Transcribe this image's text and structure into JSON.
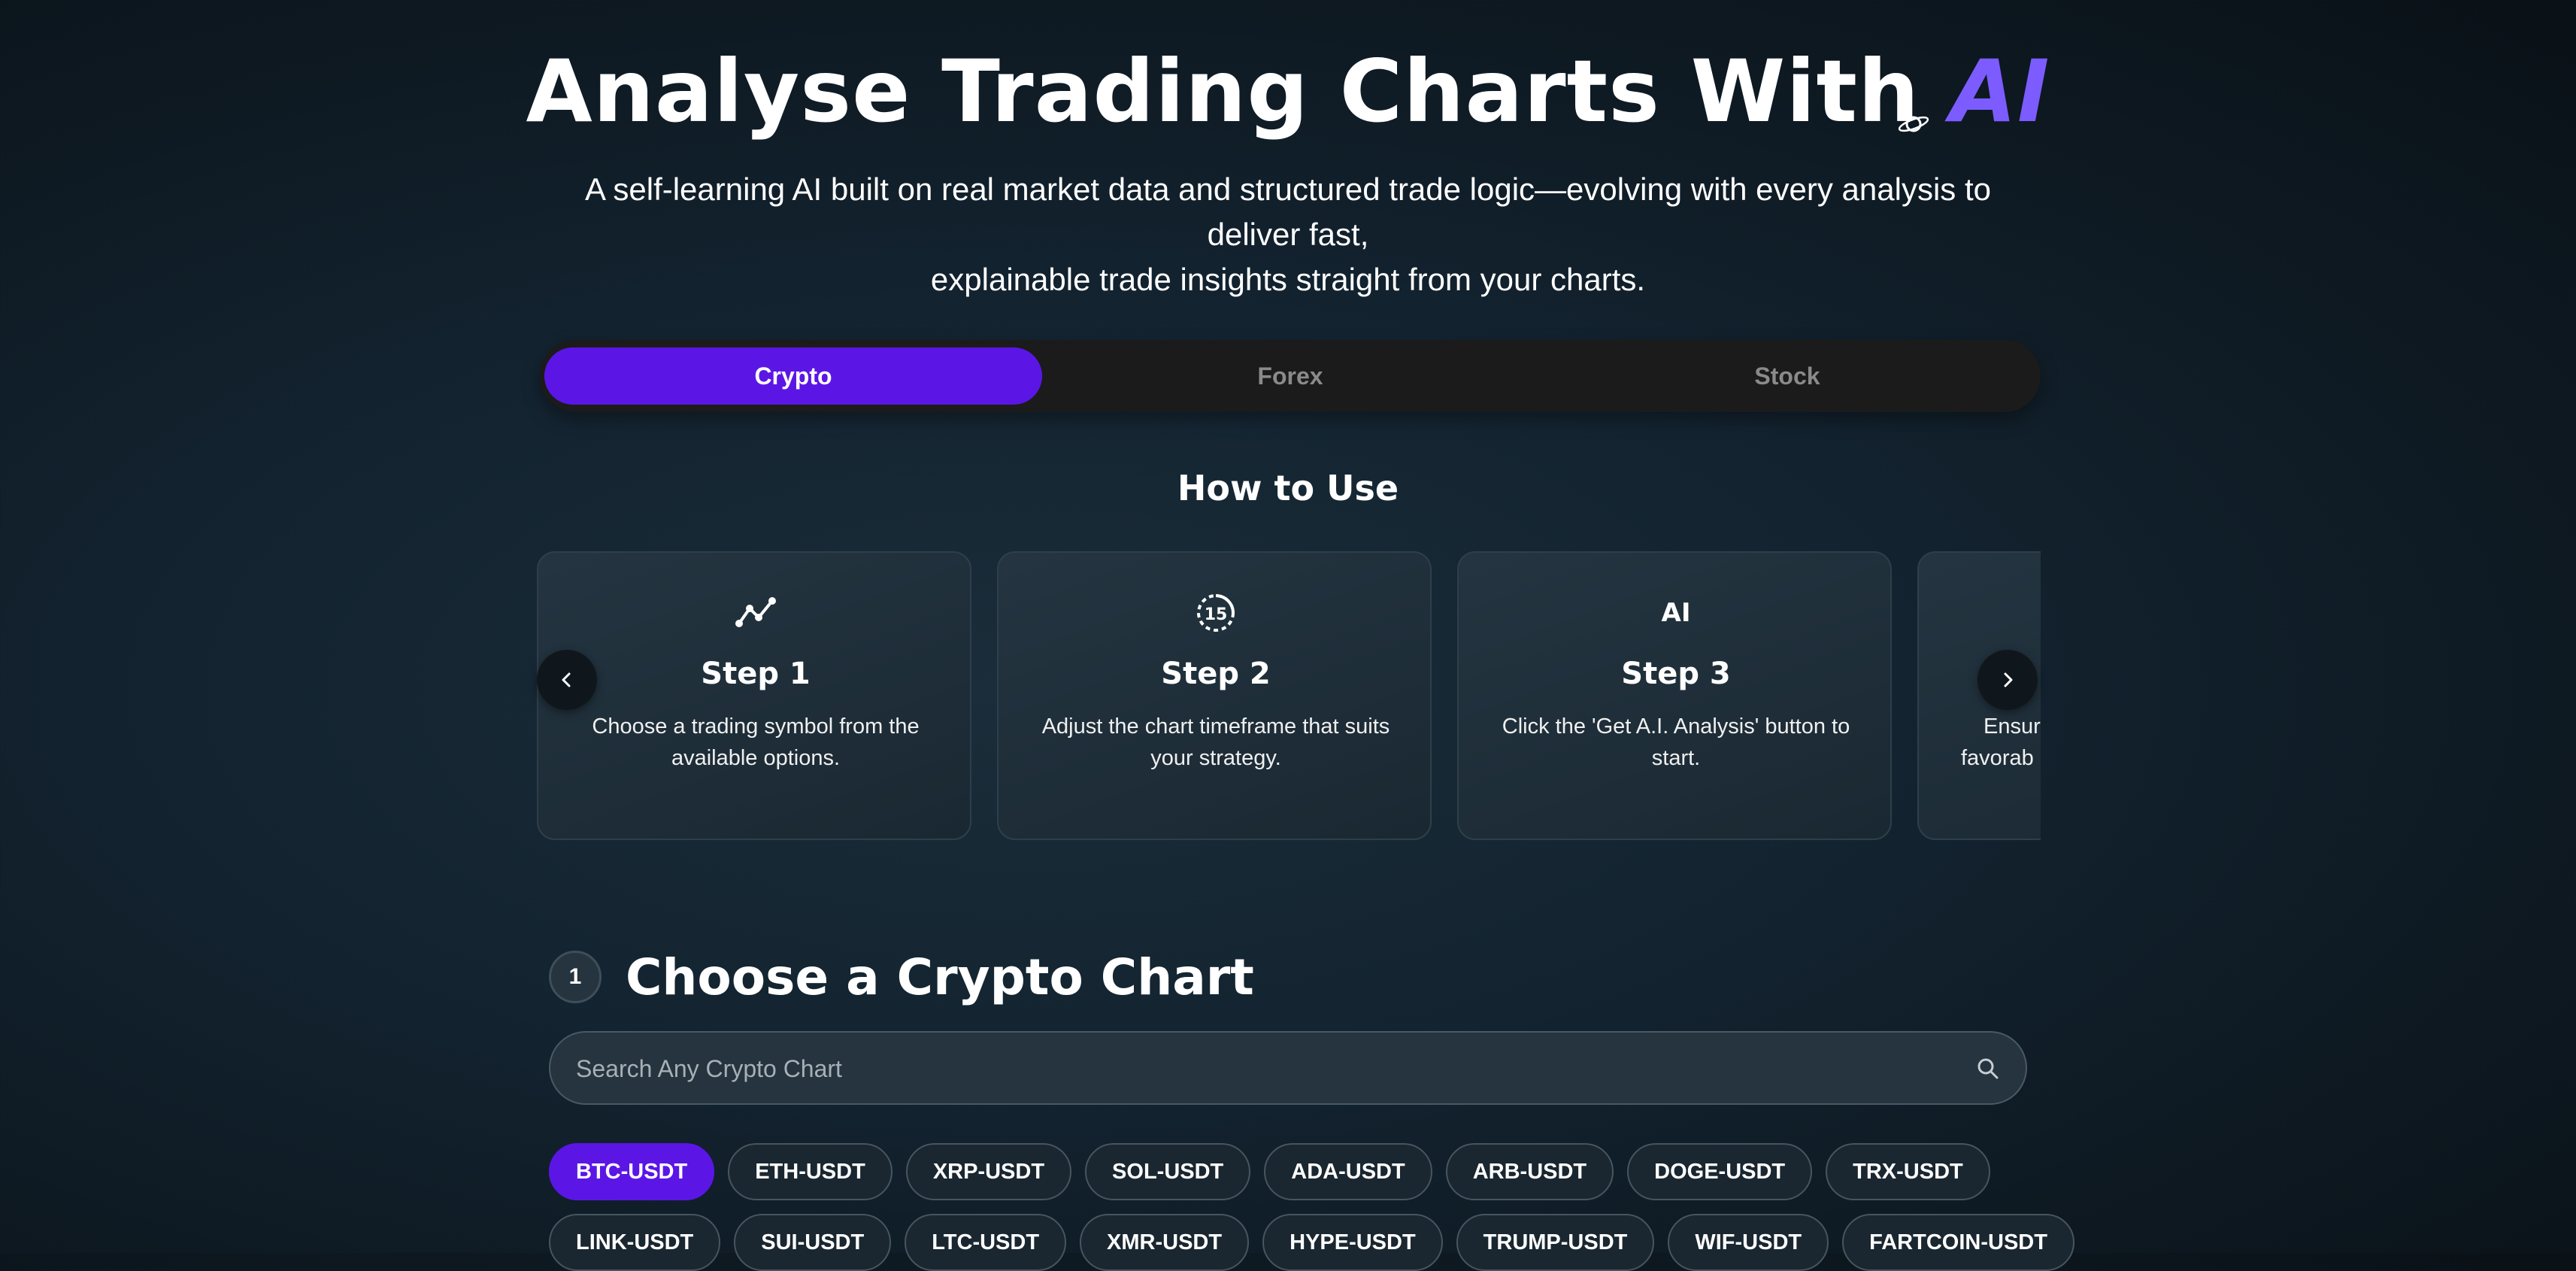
{
  "hero": {
    "title_main": "Analyse Trading Charts With ",
    "title_accent": "AI",
    "subtitle_line1": "A self-learning AI built on real market data and structured trade logic—evolving with every analysis to deliver fast,",
    "subtitle_line2": "explainable trade insights straight from your charts."
  },
  "tabs": [
    {
      "label": "Crypto",
      "active": true
    },
    {
      "label": "Forex",
      "active": false
    },
    {
      "label": "Stock",
      "active": false
    }
  ],
  "how_to_use": {
    "title": "How to Use",
    "steps": [
      {
        "icon": "trend-line-icon",
        "title": "Step 1",
        "description": "Choose a trading symbol from the available options."
      },
      {
        "icon": "timeframe-15-icon",
        "title": "Step 2",
        "description": "Adjust the chart timeframe that suits your strategy."
      },
      {
        "icon": "ai-icon",
        "icon_text": "AI",
        "title": "Step 3",
        "description": "Click the 'Get A.I. Analysis' button to start."
      },
      {
        "title": "",
        "description_line1": "Ensur",
        "description_line2": "favorab"
      }
    ]
  },
  "choose_chart": {
    "step_number": "1",
    "title": "Choose a Crypto Chart",
    "search_placeholder": "Search Any Crypto Chart"
  },
  "symbols_row1": [
    "BTC-USDT",
    "ETH-USDT",
    "XRP-USDT",
    "SOL-USDT",
    "ADA-USDT",
    "ARB-USDT",
    "DOGE-USDT",
    "TRX-USDT"
  ],
  "symbols_row2": [
    "LINK-USDT",
    "SUI-USDT",
    "LTC-USDT",
    "XMR-USDT",
    "HYPE-USDT",
    "TRUMP-USDT",
    "WIF-USDT",
    "FARTCOIN-USDT"
  ],
  "selected_symbol": "BTC-USDT",
  "colors": {
    "accent": "#5b16e6",
    "accent_text": "#7c5cff",
    "tab_bg": "#1b1b1b",
    "background": "#132330"
  }
}
